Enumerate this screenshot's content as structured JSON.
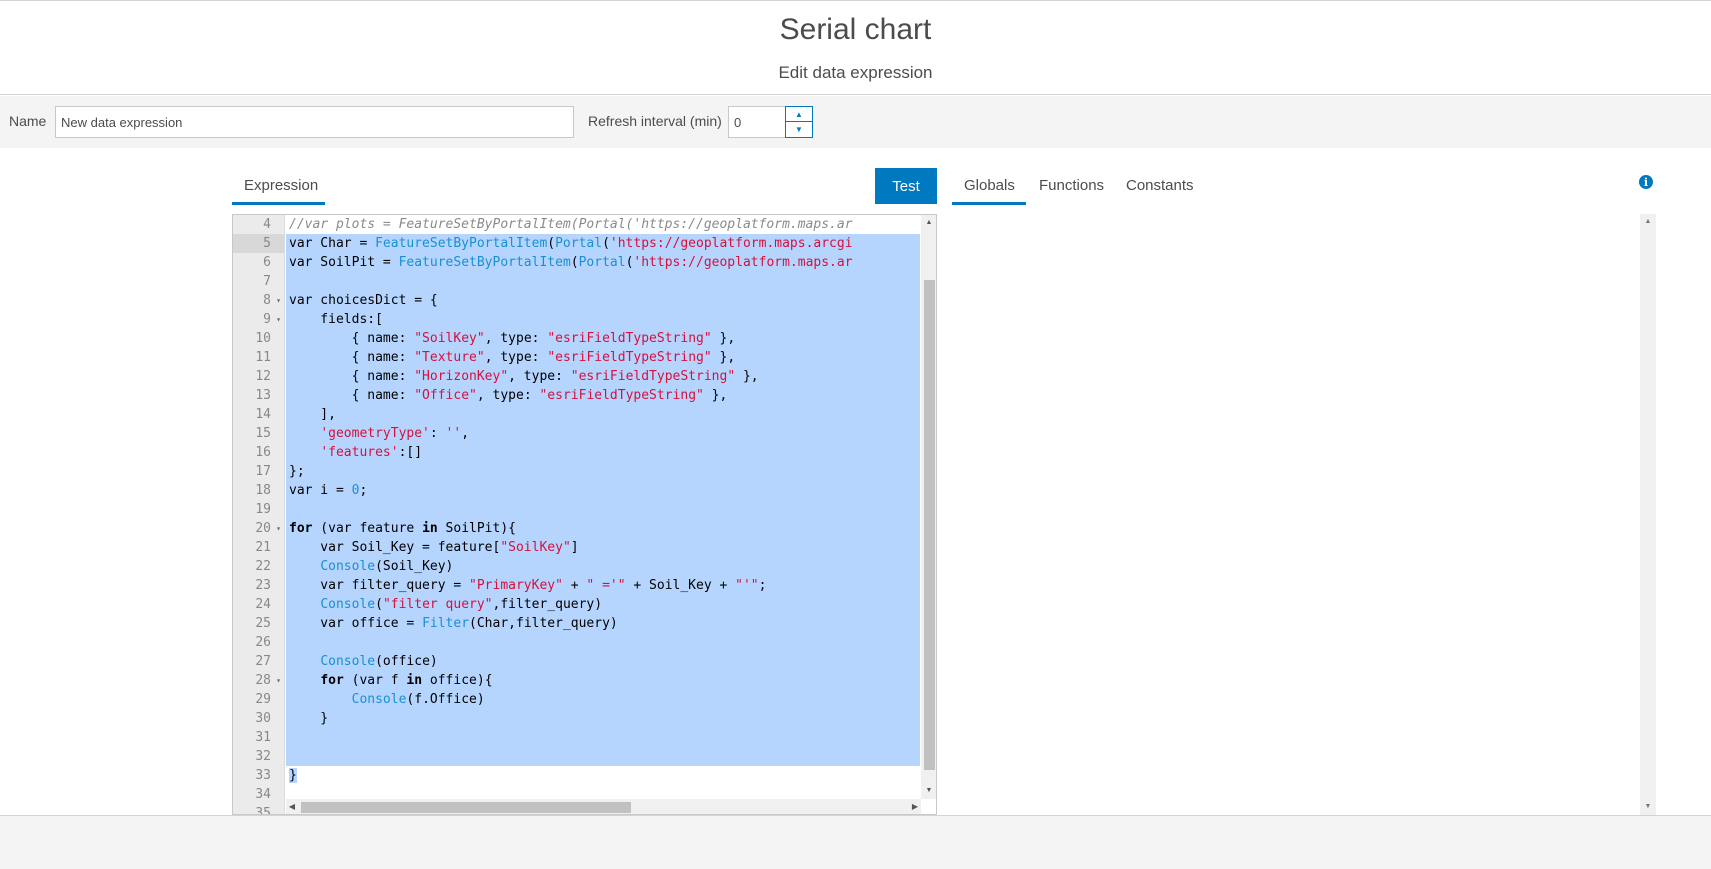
{
  "header": {
    "title": "Serial chart",
    "subtitle": "Edit data expression"
  },
  "toolbar": {
    "name_label": "Name",
    "name_value": "New data expression",
    "refresh_label": "Refresh interval (min)",
    "refresh_value": "0"
  },
  "tabs": {
    "expression": "Expression",
    "test": "Test",
    "globals": "Globals",
    "functions": "Functions",
    "constants": "Constants"
  },
  "editor": {
    "line_numbers": [
      "4",
      "5",
      "6",
      "7",
      "8",
      "9",
      "10",
      "11",
      "12",
      "13",
      "14",
      "15",
      "16",
      "17",
      "18",
      "19",
      "20",
      "21",
      "22",
      "23",
      "24",
      "25",
      "26",
      "27",
      "28",
      "29",
      "30",
      "31",
      "32",
      "33",
      "34",
      "35"
    ],
    "fold_lines": [
      "8",
      "9",
      "20",
      "28"
    ],
    "lines": [
      "//var plots = FeatureSetByPortalItem(Portal('https://geoplatform.maps.ar",
      "var Char = FeatureSetByPortalItem(Portal('https://geoplatform.maps.arcgi",
      "var SoilPit = FeatureSetByPortalItem(Portal('https://geoplatform.maps.ar",
      "",
      "var choicesDict = {",
      "    fields:[",
      "        { name: \"SoilKey\", type: \"esriFieldTypeString\" },",
      "        { name: \"Texture\", type: \"esriFieldTypeString\" },",
      "        { name: \"HorizonKey\", type: \"esriFieldTypeString\" },",
      "        { name: \"Office\", type: \"esriFieldTypeString\" },",
      "    ],",
      "    'geometryType': '',",
      "    'features':[]",
      "};",
      "var i = 0;",
      "",
      "for (var feature in SoilPit){",
      "    var Soil_Key = feature[\"SoilKey\"]",
      "    Console(Soil_Key)",
      "    var filter_query = \"PrimaryKey\" + \" ='\" + Soil_Key + \"'\";",
      "    Console(\"filter query\",filter_query)",
      "    var office = Filter(Char,filter_query)",
      "",
      "    Console(office)",
      "    for (var f in office){",
      "        Console(f.Office)",
      "    }",
      "",
      "",
      "}",
      "",
      ""
    ]
  },
  "colors": {
    "accent": "#0079c1",
    "selection": "#b5d5ff",
    "string": "#d6113c",
    "function": "#1a8fd1",
    "comment": "#8a8a8a"
  },
  "icons": {
    "info": "info-icon"
  }
}
